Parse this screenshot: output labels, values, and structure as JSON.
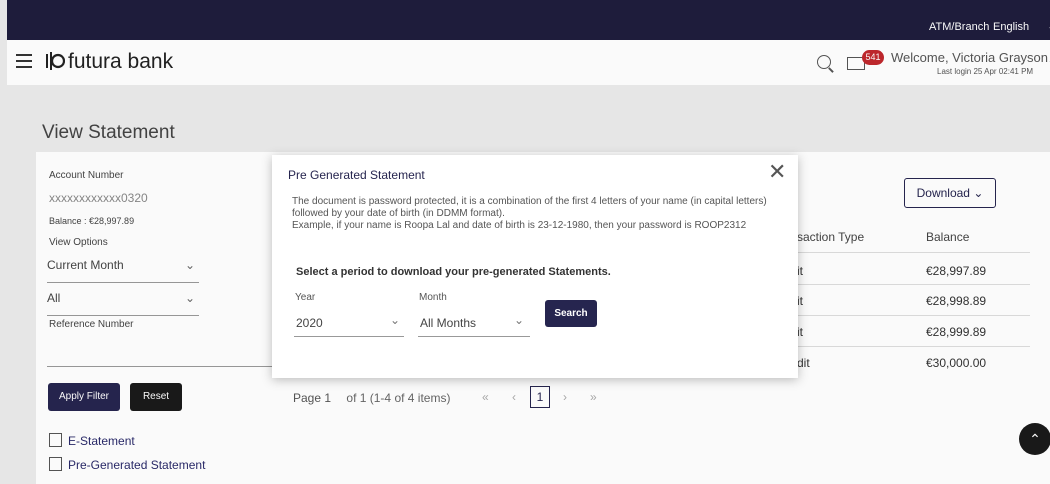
{
  "topbar": {
    "atm_branch": "ATM/Branch",
    "language": "English"
  },
  "header": {
    "brand": "futura bank",
    "mail_count": "541",
    "welcome": "Welcome, Victoria Grayson",
    "last_login": "Last login 25 Apr 02:41 PM"
  },
  "page": {
    "title": "View Statement"
  },
  "filters": {
    "account_number_label": "Account Number",
    "account_number": "xxxxxxxxxxxx0320",
    "balance": "Balance : €28,997.89",
    "view_options_label": "View Options",
    "period": "Current Month",
    "type": "All",
    "reference_label": "Reference Number",
    "apply_label": "Apply Filter",
    "reset_label": "Reset"
  },
  "links": {
    "estatement": "E-Statement",
    "pregenerated": "Pre-Generated Statement"
  },
  "table": {
    "download_label": "Download",
    "columns": [
      "saction Type",
      "Balance"
    ],
    "rows": [
      {
        "type": "it",
        "balance": "€28,997.89"
      },
      {
        "type": "it",
        "balance": "€28,998.89"
      },
      {
        "type": "it",
        "balance": "€28,999.89"
      },
      {
        "type": "dit",
        "balance": "€30,000.00"
      }
    ]
  },
  "pager": {
    "page_label": "Page",
    "page": "1",
    "of": "of 1",
    "items": "(1-4 of 4 items)",
    "current": "1"
  },
  "modal": {
    "title": "Pre Generated Statement",
    "line1": "The document is password protected, it is a combination of the first 4 letters of your name (in capital letters) followed by your date of birth (in DDMM format).",
    "line2": "Example, if your name is Roopa Lal and date of birth is 23-12-1980, then your password is ROOP2312",
    "subtitle": "Select a period to download your pre-generated Statements.",
    "year_label": "Year",
    "year": "2020",
    "month_label": "Month",
    "month": "All Months",
    "search_label": "Search"
  }
}
